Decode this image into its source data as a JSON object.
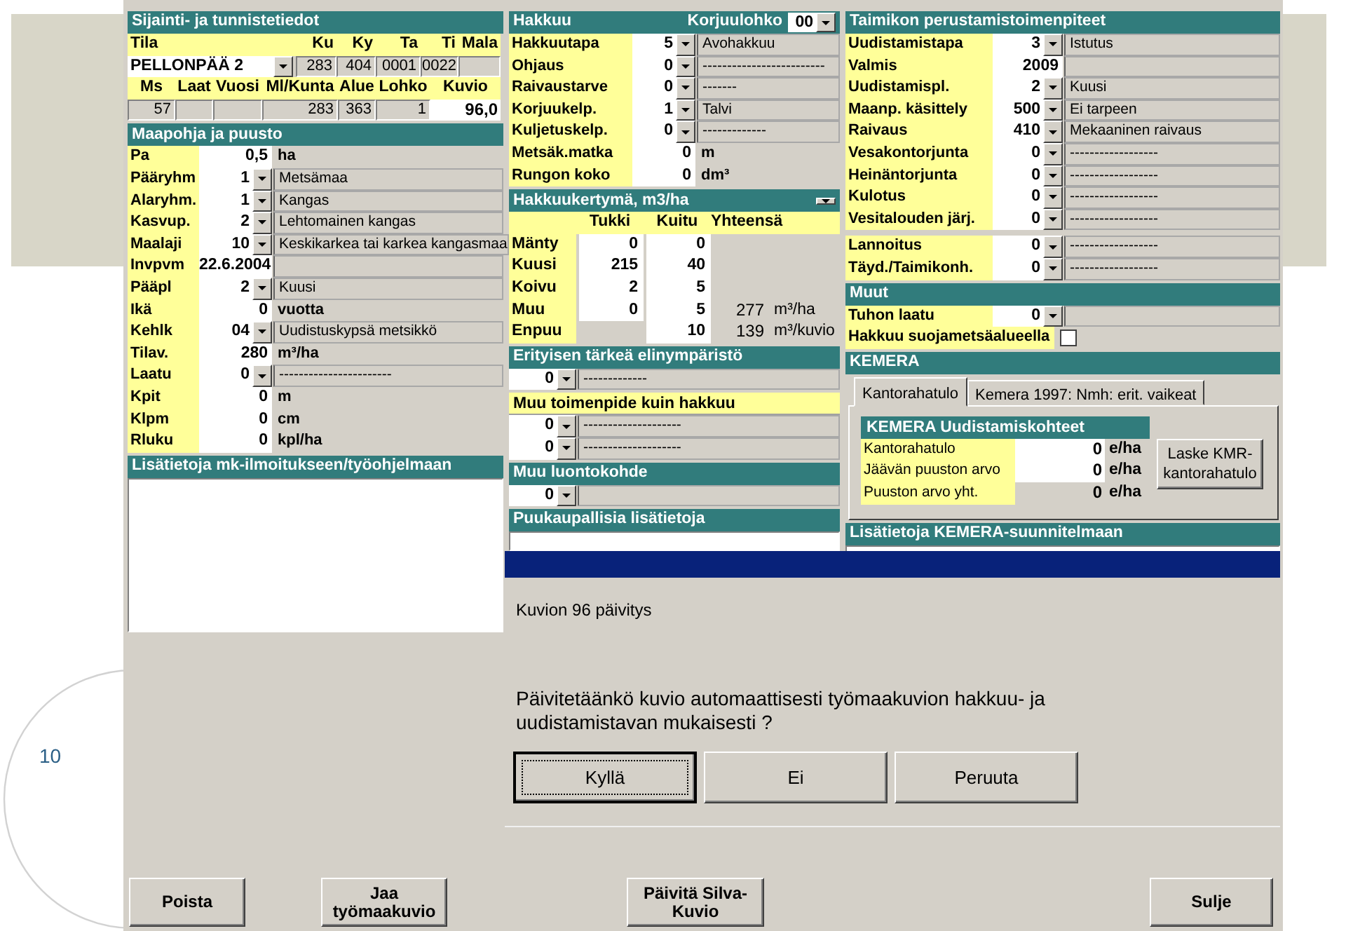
{
  "slide_number": "10",
  "columns": [
    {
      "sections": [
        {
          "kind": "grid",
          "title": "Sijainti- ja tunnistetiedot",
          "row_groups": [
            {
              "cells": [
                {
                  "header": "Tila",
                  "value": "PELLONPÄÄ 2",
                  "kind": "combo"
                },
                {
                  "header": "Ku",
                  "value": "283",
                  "kind": "readonly"
                },
                {
                  "header": "Ky",
                  "value": "404",
                  "kind": "readonly"
                },
                {
                  "header": "Ta",
                  "value": "0001",
                  "kind": "readonly"
                },
                {
                  "header": "Ti",
                  "value": "0022",
                  "kind": "readonly"
                },
                {
                  "header": "Mala",
                  "kind": "readonly"
                }
              ]
            },
            {
              "cells": [
                {
                  "header": "Ms",
                  "value": "57",
                  "kind": "readonly"
                },
                {
                  "header": "Laat",
                  "kind": "readonly"
                },
                {
                  "header": "Vuosi",
                  "kind": "readonly"
                },
                {
                  "header": "Ml/Kunta",
                  "value": "283",
                  "kind": "readonly"
                },
                {
                  "header": "Alue",
                  "value": "363",
                  "kind": "readonly"
                },
                {
                  "header": "Lohko",
                  "value": "1",
                  "kind": "readonly"
                },
                {
                  "header": "Kuvio",
                  "value": "96,0",
                  "kind": "input"
                }
              ]
            }
          ]
        },
        {
          "kind": "form",
          "title": "Maapohja ja puusto",
          "fields": [
            {
              "label": "Pa",
              "kind": "input",
              "value": "0,5",
              "unit": "ha"
            },
            {
              "label": "Pääryhm",
              "kind": "combo",
              "value": "1",
              "description": "Metsämaa"
            },
            {
              "label": "Alaryhm.",
              "kind": "combo",
              "value": "1",
              "description": "Kangas"
            },
            {
              "label": "Kasvup.",
              "kind": "combo",
              "value": "2",
              "description": "Lehtomainen kangas"
            },
            {
              "label": "Maalaji",
              "kind": "combo",
              "value": "10",
              "description": "Keskikarkea tai karkea kangasmaa"
            },
            {
              "label": "Invpvm",
              "kind": "input",
              "value": "22.6.2004"
            },
            {
              "label": "Pääpl",
              "kind": "combo",
              "value": "2",
              "description": "Kuusi"
            },
            {
              "label": "Ikä",
              "kind": "input",
              "value": "0",
              "unit": "vuotta"
            },
            {
              "label": "Kehlk",
              "kind": "combo",
              "value": "04",
              "description": "Uudistuskypsä metsikkö"
            },
            {
              "label": "Tilav.",
              "kind": "input",
              "value": "280",
              "unit": "m³/ha"
            },
            {
              "label": "Laatu",
              "kind": "combo",
              "value": "0",
              "description": "-----------------------"
            },
            {
              "label": "Kpit",
              "kind": "input",
              "value": "0",
              "unit": "m"
            },
            {
              "label": "Klpm",
              "kind": "input",
              "value": "0",
              "unit": "cm"
            },
            {
              "label": "Rluku",
              "kind": "input",
              "value": "0",
              "unit": "kpl/ha"
            }
          ]
        },
        {
          "kind": "notes",
          "title": "Lisätietoja mk-ilmoitukseen/työohjelmaan"
        }
      ]
    },
    {
      "sections": [
        {
          "kind": "form",
          "title": "Hakkuu",
          "extra_label": "Korjuulohko",
          "extra_value": "00",
          "fields": [
            {
              "label": "Hakkuutapa",
              "kind": "combo",
              "value": "5",
              "description": "Avohakkuu"
            },
            {
              "label": "Ohjaus",
              "kind": "combo",
              "value": "0",
              "description": "-------------------------"
            },
            {
              "label": "Raivaustarve",
              "kind": "combo",
              "value": "0",
              "description": "-------"
            },
            {
              "label": "Korjuukelp.",
              "kind": "combo",
              "value": "1",
              "description": "Talvi"
            },
            {
              "label": "Kuljetuskelp.",
              "kind": "combo",
              "value": "0",
              "description": "-------------"
            },
            {
              "label": "Metsäk.matka",
              "kind": "input",
              "value": "0",
              "unit": "m"
            },
            {
              "label": "Rungon koko",
              "kind": "input",
              "value": "0",
              "unit": "dm³"
            }
          ]
        },
        {
          "kind": "table",
          "title": "Hakkuukertymä, m3/ha",
          "dropdown": true,
          "columns": [
            "Tukki",
            "Kuitu",
            "Yhteensä"
          ],
          "rows": [
            {
              "label": "Mänty",
              "tukki": "0",
              "kuitu": "0"
            },
            {
              "label": "Kuusi",
              "tukki": "215",
              "kuitu": "40"
            },
            {
              "label": "Koivu",
              "tukki": "2",
              "kuitu": "5"
            },
            {
              "label": "Muu",
              "tukki": "0",
              "kuitu": "5",
              "total": "277",
              "unit": "m³/ha"
            },
            {
              "label": "Enpuu",
              "kuitu": "10",
              "total": "139",
              "unit": "m³/kuvio"
            }
          ]
        },
        {
          "kind": "form",
          "title": "Erityisen tärkeä elinympäristö",
          "fields": [
            {
              "kind": "combo",
              "value": "0",
              "description": "-------------"
            }
          ]
        },
        {
          "kind": "form",
          "title": "Muu toimenpide kuin hakkuu",
          "heading_highlighted": true,
          "fields": [
            {
              "kind": "combo",
              "value": "0",
              "description": "--------------------"
            },
            {
              "kind": "combo",
              "value": "0",
              "description": "--------------------"
            }
          ]
        },
        {
          "kind": "form",
          "title": "Muu luontokohde",
          "fields": [
            {
              "kind": "combo",
              "value": "0"
            }
          ]
        },
        {
          "kind": "notes",
          "title": "Puukaupallisia lisätietoja"
        }
      ]
    },
    {
      "sections": [
        {
          "kind": "form",
          "title": "Taimikon perustamistoimenpiteet",
          "fields": [
            {
              "label": "Uudistamistapa",
              "kind": "combo",
              "value": "3",
              "description": "Istutus"
            },
            {
              "label": "Valmis",
              "kind": "input",
              "value": "2009"
            },
            {
              "label": "Uudistamispl.",
              "kind": "combo",
              "value": "2",
              "description": "Kuusi"
            },
            {
              "label": "Maanp. käsittely",
              "kind": "combo",
              "value": "500",
              "description": "Ei tarpeen"
            },
            {
              "label": "Raivaus",
              "kind": "combo",
              "value": "410",
              "description": "Mekaaninen raivaus"
            },
            {
              "label": "Vesakontorjunta",
              "kind": "combo",
              "value": "0",
              "description": "------------------"
            },
            {
              "label": "Heinäntorjunta",
              "kind": "combo",
              "value": "0",
              "description": "------------------"
            },
            {
              "label": "Kulotus",
              "kind": "combo",
              "value": "0",
              "description": "------------------"
            },
            {
              "label": "Vesitalouden järj.",
              "kind": "combo",
              "value": "0",
              "description": "------------------"
            },
            {
              "label": "Lannoitus",
              "kind": "combo",
              "value": "0",
              "description": "------------------",
              "separator_before": true
            },
            {
              "label": "Täyd./Taimikonh.",
              "kind": "combo",
              "value": "0",
              "description": "------------------"
            }
          ]
        },
        {
          "kind": "form",
          "title": "Muut",
          "fields": [
            {
              "label": "Tuhon laatu",
              "kind": "combo",
              "value": "0"
            },
            {
              "label": "Hakkuu suojametsäalueella",
              "kind": "checkbox",
              "checked": false
            }
          ]
        },
        {
          "kind": "tabs",
          "title": "KEMERA",
          "tabs": [
            {
              "label": "Kantorahatulo",
              "selected": true
            },
            {
              "label": "Kemera 1997: Nmh: erit. vaikeat",
              "selected": false
            }
          ],
          "panel": {
            "title": "KEMERA Uudistamiskohteet",
            "rows": [
              {
                "label": "Kantorahatulo",
                "value": "0",
                "unit": "e/ha",
                "editable": true
              },
              {
                "label": "Jäävän puuston arvo",
                "value": "0",
                "unit": "e/ha",
                "editable": true
              },
              {
                "label": "Puuston arvo yht.",
                "value": "0",
                "unit": "e/ha",
                "editable": false
              }
            ],
            "button": "Laske KMR-kantorahatulo"
          }
        },
        {
          "kind": "notes",
          "title": "Lisätietoja KEMERA-suunnitelmaan"
        }
      ]
    }
  ],
  "dialog": {
    "heading": "Kuvion 96 päivitys",
    "message": "Päivitetäänkö kuvio automaattisesti työmaakuvion hakkuu- ja uudistamistavan mukaisesti ?",
    "buttons": [
      {
        "label": "Kyllä",
        "focused": true
      },
      {
        "label": "Ei",
        "focused": false
      },
      {
        "label": "Peruuta",
        "focused": false
      }
    ]
  },
  "bottom_buttons": [
    "Poista",
    "Jaa työmaakuvio",
    "Päivitä Silva-Kuvio",
    "Sulje"
  ]
}
